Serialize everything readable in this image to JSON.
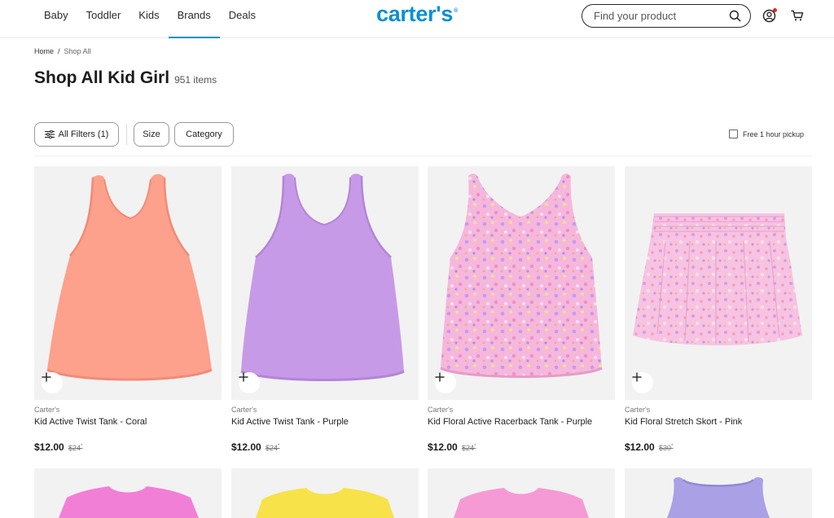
{
  "header": {
    "nav": [
      "Baby",
      "Toddler",
      "Kids",
      "Brands",
      "Deals"
    ],
    "active_nav": "Brands",
    "logo": "carter's",
    "logo_reg": "®",
    "search_placeholder": "Find your product",
    "brand_color": "#0a8fd6",
    "accent_color": "#1a8fc7"
  },
  "breadcrumb": {
    "home": "Home",
    "separator": "/",
    "current": "Shop All"
  },
  "page": {
    "title": "Shop All Kid Girl",
    "count": "951 items"
  },
  "filters": {
    "all_filters": "All Filters (1)",
    "size": "Size",
    "category": "Category",
    "pickup": "Free 1 hour pickup"
  },
  "products": [
    {
      "brand": "Carter's",
      "name": "Kid Active Twist Tank - Coral",
      "price": "$12.00",
      "original": "$24",
      "original_mark": "*",
      "color": "#fda08c"
    },
    {
      "brand": "Carter's",
      "name": "Kid Active Twist Tank - Purple",
      "price": "$12.00",
      "original": "$24",
      "original_mark": "*",
      "color": "#c79ae8"
    },
    {
      "brand": "Carter's",
      "name": "Kid Floral Active Racerback Tank - Purple",
      "price": "$12.00",
      "original": "$24",
      "original_mark": "*",
      "color": "#f3b3d9"
    },
    {
      "brand": "Carter's",
      "name": "Kid Floral Stretch Skort - Pink",
      "price": "$12.00",
      "original": "$30",
      "original_mark": "*",
      "color": "#f6c2df"
    }
  ],
  "row2_colors": [
    "#f27fd6",
    "#f7e24a",
    "#f59ad4",
    "#a9a0e6"
  ]
}
